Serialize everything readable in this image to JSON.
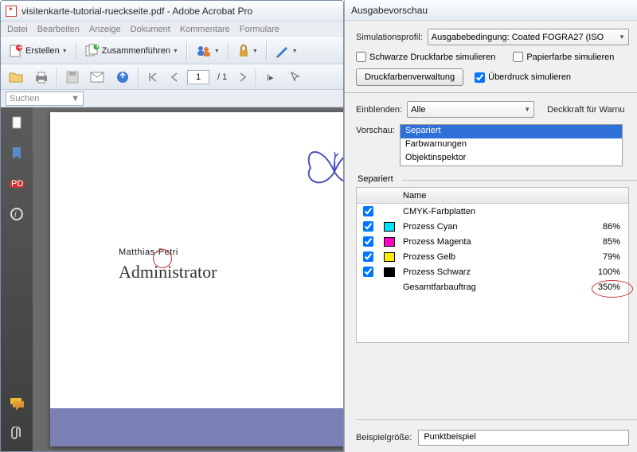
{
  "window": {
    "title": "visitenkarte-tutorial-rueckseite.pdf - Adobe Acrobat Pro"
  },
  "menubar": [
    "Datei",
    "Bearbeiten",
    "Anzeige",
    "Dokument",
    "Kommentare",
    "Formulare"
  ],
  "toolbar1": {
    "create": "Erstellen",
    "merge": "Zusammenführen"
  },
  "toolbar2": {
    "page_current": "1",
    "page_total": "/ 1"
  },
  "search": {
    "placeholder": "Suchen"
  },
  "document": {
    "name_first": "Matthias",
    "name_hyphen": "-",
    "name_last": "Petri",
    "role": "Administrator"
  },
  "panel": {
    "title": "Ausgabevorschau",
    "sim_label": "Simulationsprofil:",
    "sim_value": "Ausgabebedingung: Coated FOGRA27 (ISO",
    "chk_black": "Schwarze Druckfarbe simulieren",
    "chk_paper": "Papierfarbe simulieren",
    "btn_ink": "Druckfarbenverwaltung",
    "chk_overprint": "Überdruck simulieren",
    "show_label": "Einblenden:",
    "show_value": "Alle",
    "opacity_label": "Deckkraft für Warnu",
    "preview_label": "Vorschau:",
    "preview_options": [
      "Separiert",
      "Farbwarnungen",
      "Objektinspektor"
    ],
    "group_title": "Separiert",
    "table_header": "Name",
    "rows": [
      {
        "checked": true,
        "swatch": "",
        "name": "CMYK-Farbplatten",
        "pct": ""
      },
      {
        "checked": true,
        "swatch": "#00e5ff",
        "name": "Prozess Cyan",
        "pct": "86%"
      },
      {
        "checked": true,
        "swatch": "#ff00c8",
        "name": "Prozess Magenta",
        "pct": "85%"
      },
      {
        "checked": true,
        "swatch": "#ffec00",
        "name": "Prozess Gelb",
        "pct": "79%"
      },
      {
        "checked": true,
        "swatch": "#000000",
        "name": "Prozess Schwarz",
        "pct": "100%"
      },
      {
        "checked": false,
        "swatch": "",
        "name": "Gesamtfarbauftrag",
        "pct": "350%",
        "highlight": true
      }
    ],
    "sample_label": "Beispielgröße:",
    "sample_value": "Punktbeispiel"
  }
}
